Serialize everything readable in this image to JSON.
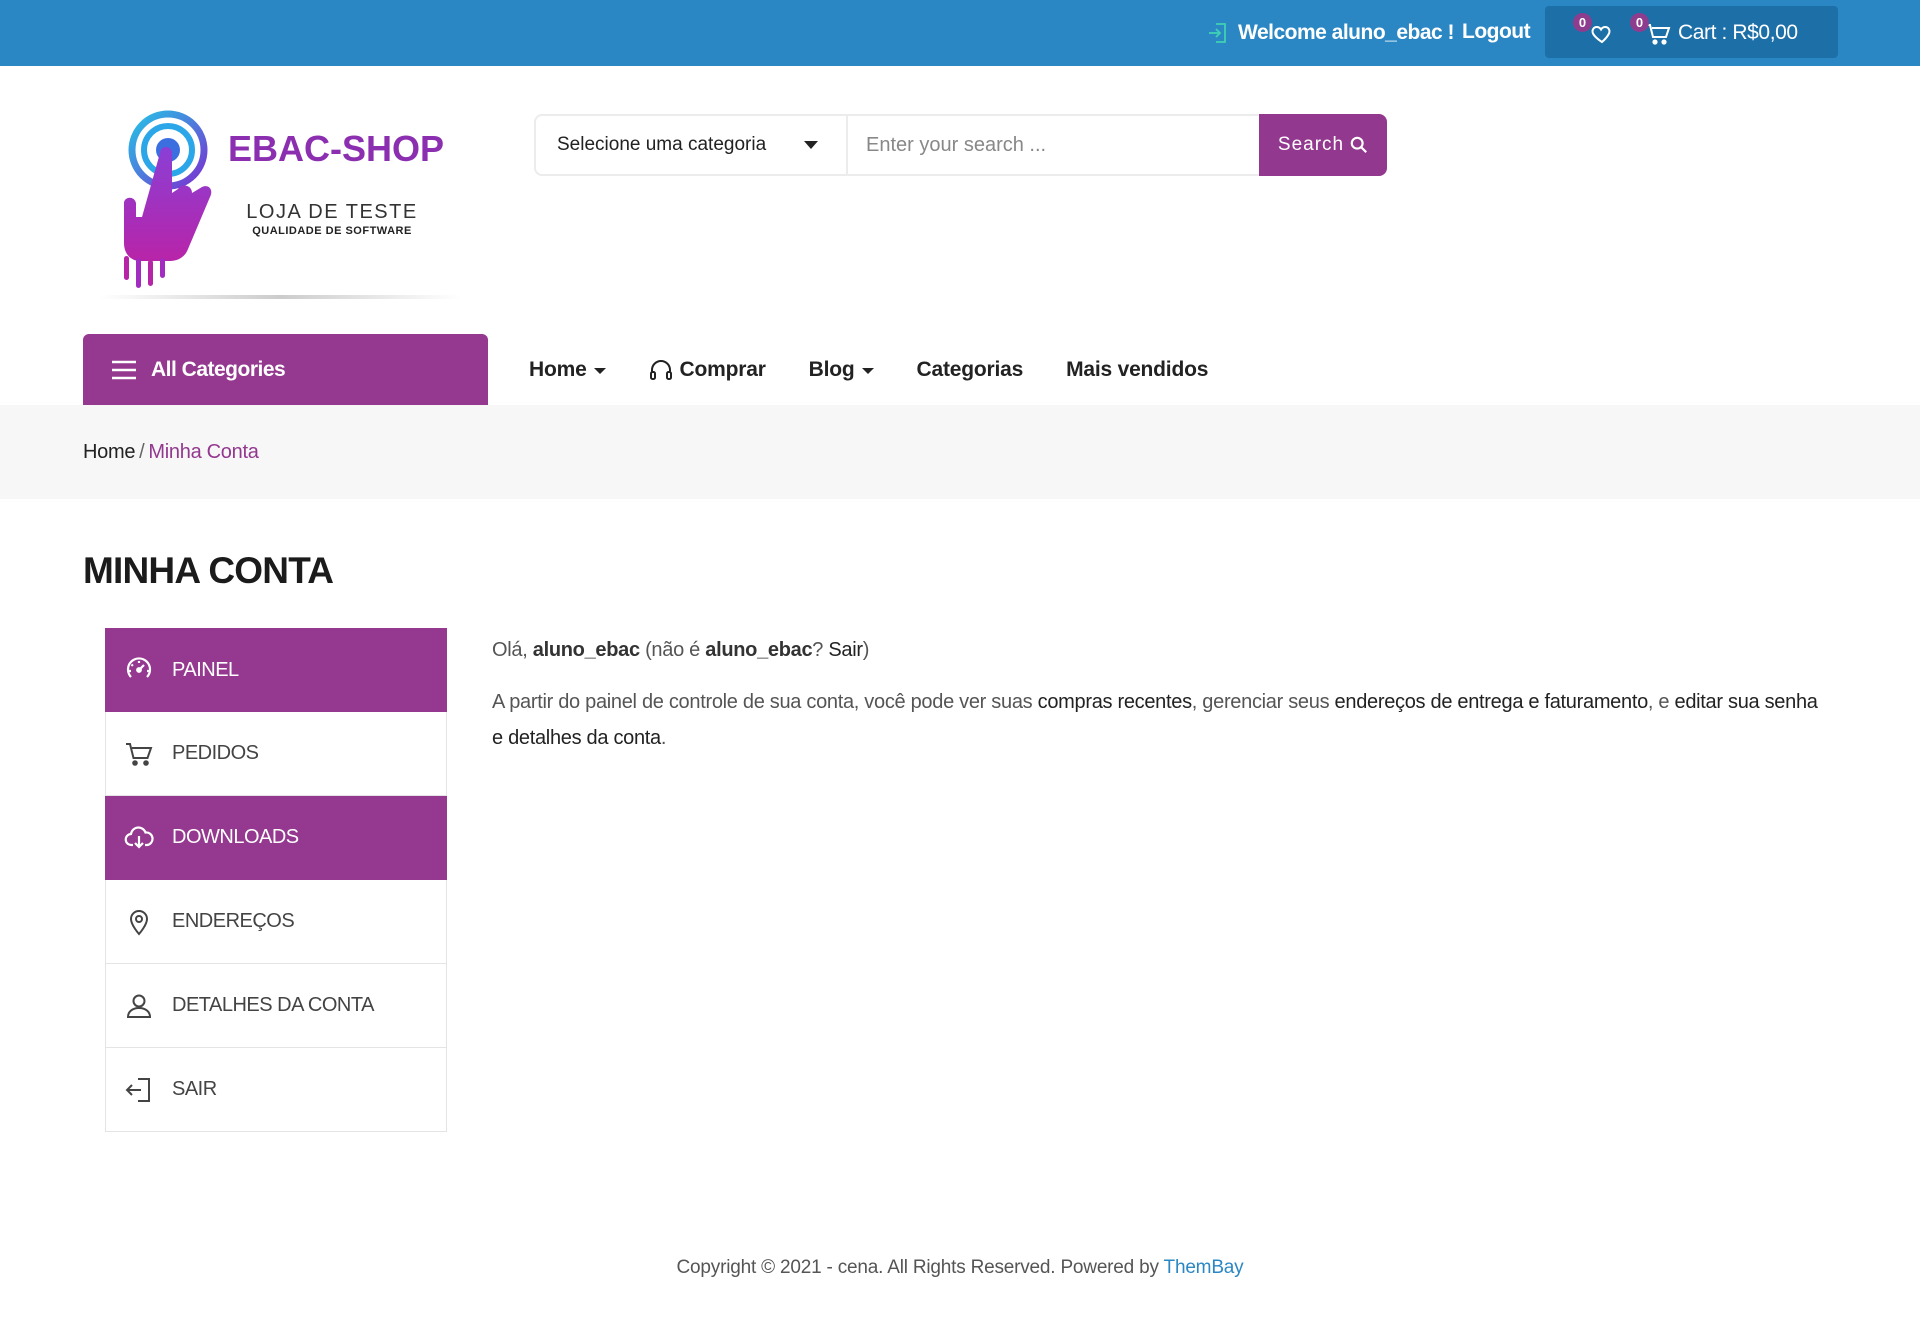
{
  "colors": {
    "topbar": "#2b87c4",
    "cart_box": "#1d6fa8",
    "accent": "#94398f",
    "link": "#2b87c4"
  },
  "topbar": {
    "welcome": "Welcome aluno_ebac !",
    "logout": "Logout",
    "wishlist_count": "0",
    "cart_count": "0",
    "cart_label": "Cart : R$0,00"
  },
  "logo": {
    "brand": "EBAC-SHOP",
    "line1": "LOJA DE TESTE",
    "line2": "QUALIDADE DE SOFTWARE"
  },
  "search": {
    "category": "Selecione uma categoria",
    "placeholder": "Enter your search ...",
    "button": "Search"
  },
  "nav": {
    "all_categories": "All Categories",
    "items": [
      {
        "label": "Home"
      },
      {
        "label": "Comprar"
      },
      {
        "label": "Blog"
      },
      {
        "label": "Categorias"
      },
      {
        "label": "Mais vendidos"
      }
    ]
  },
  "breadcrumb": {
    "home": "Home",
    "separator": "/",
    "current": "Minha Conta"
  },
  "page_title": "MINHA CONTA",
  "account_nav": [
    {
      "label": "PAINEL",
      "icon": "dashboard-icon"
    },
    {
      "label": "PEDIDOS",
      "icon": "cart-icon"
    },
    {
      "label": "DOWNLOADS",
      "icon": "cloud-download-icon"
    },
    {
      "label": "ENDEREÇOS",
      "icon": "location-pin-icon"
    },
    {
      "label": "DETALHES DA CONTA",
      "icon": "user-icon"
    },
    {
      "label": "SAIR",
      "icon": "logout-icon"
    }
  ],
  "content": {
    "greet_hello": "Olá,",
    "username": "aluno_ebac",
    "greet_not": "(não é",
    "username2": "aluno_ebac",
    "greet_q": "?",
    "sair": "Sair",
    "greet_close": ")",
    "p_start": "A partir do painel de controle de sua conta, você pode ver suas",
    "link_orders": "compras recentes",
    "p_mid": ", gerenciar seus",
    "link_addresses": "endereços de entrega e faturamento",
    "p_mid2": ", e",
    "link_account": "editar sua senha e detalhes da conta",
    "p_end": "."
  },
  "footer": {
    "text": "Copyright © 2021 - cena. All Rights Reserved. Powered by",
    "link": "ThemBay"
  }
}
